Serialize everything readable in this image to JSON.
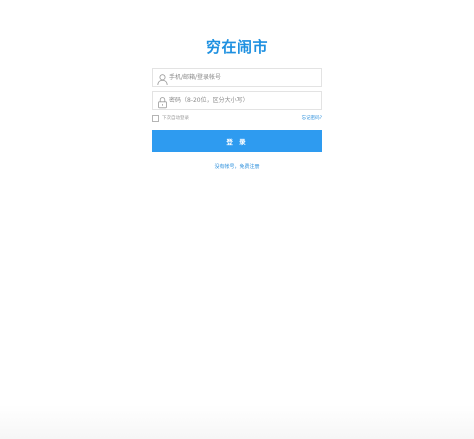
{
  "brand": {
    "title": "穷在闹市"
  },
  "login_form": {
    "account_placeholder": "手机/邮箱/登录帐号",
    "password_placeholder": "密码（8-20位，区分大小写）",
    "remember_label": "下次自动登录",
    "forgot_label": "忘记密码?",
    "submit_label": "登 录",
    "register_label": "没有帐号，免费注册"
  },
  "icons": {
    "account": "user-icon",
    "password": "lock-icon"
  },
  "colors": {
    "accent": "#2e9bf0",
    "title": "#1e90e0",
    "link": "#2b8fdc"
  }
}
